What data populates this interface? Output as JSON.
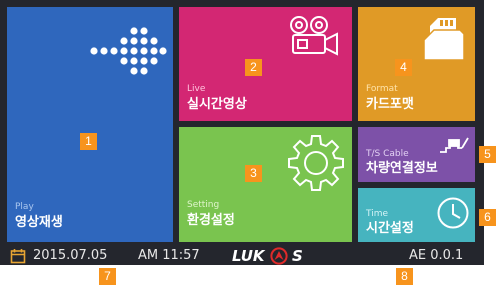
{
  "tiles": {
    "play": {
      "sub": "Play",
      "main": "영상재생",
      "badge": "1"
    },
    "live": {
      "sub": "Live",
      "main": "실시간영상",
      "badge": "2"
    },
    "setting": {
      "sub": "Setting",
      "main": "환경설정",
      "badge": "3"
    },
    "format": {
      "sub": "Format",
      "main": "카드포맷",
      "badge": "4"
    },
    "ts_cable": {
      "sub": "T/S Cable",
      "main": "차량연결정보",
      "badge": "5"
    },
    "time": {
      "sub": "Time",
      "main": "시간설정",
      "badge": "6"
    }
  },
  "status": {
    "date": "2015.07.05",
    "time": "AM 11:57",
    "brand_left": "LUK",
    "brand_right": "S",
    "mode": "AE 0.0.1",
    "date_badge": "7",
    "mode_badge": "8"
  },
  "colors": {
    "play": "#2f67bd",
    "live": "#d32773",
    "setting": "#7ac44f",
    "format": "#e09a26",
    "ts_cable": "#7d51a8",
    "time": "#46b4bf",
    "badge": "#f7941d",
    "background": "#24262d",
    "logo_red": "#e02a2a"
  },
  "icons": {
    "play": "arrow-right-dots-icon",
    "live": "video-camera-icon",
    "setting": "gear-icon",
    "format": "sd-card-icon",
    "ts_cable": "cable-icon",
    "time": "clock-icon",
    "date": "calendar-icon"
  }
}
